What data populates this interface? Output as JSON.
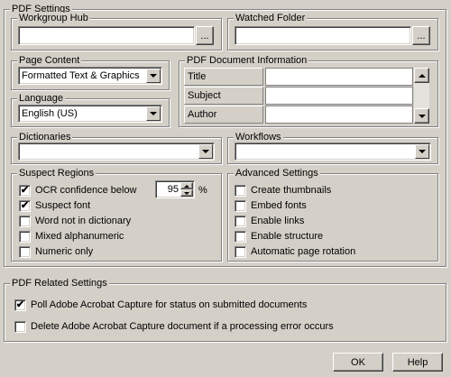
{
  "pdf_settings": {
    "title": "PDF Settings"
  },
  "workgroup_hub": {
    "label": "Workgroup Hub",
    "value": "",
    "browse": "..."
  },
  "watched_folder": {
    "label": "Watched Folder",
    "value": "",
    "browse": "..."
  },
  "page_content": {
    "label": "Page Content",
    "value": "Formatted Text & Graphics"
  },
  "language": {
    "label": "Language",
    "value": "English (US)"
  },
  "pdf_doc_info": {
    "label": "PDF Document Information",
    "rows": [
      {
        "name": "Title",
        "value": ""
      },
      {
        "name": "Subject",
        "value": ""
      },
      {
        "name": "Author",
        "value": ""
      }
    ]
  },
  "dictionaries": {
    "label": "Dictionaries",
    "value": ""
  },
  "workflows": {
    "label": "Workflows",
    "value": ""
  },
  "suspect_regions": {
    "label": "Suspect Regions",
    "items": [
      {
        "label": "OCR confidence below",
        "checked": true
      },
      {
        "label": "Suspect font",
        "checked": true
      },
      {
        "label": "Word not in dictionary",
        "checked": false
      },
      {
        "label": "Mixed alphanumeric",
        "checked": false
      },
      {
        "label": "Numeric only",
        "checked": false
      }
    ],
    "confidence_value": "95",
    "percent": "%"
  },
  "advanced_settings": {
    "label": "Advanced Settings",
    "items": [
      {
        "label": "Create thumbnails",
        "checked": false
      },
      {
        "label": "Embed fonts",
        "checked": false
      },
      {
        "label": "Enable links",
        "checked": false
      },
      {
        "label": "Enable structure",
        "checked": false
      },
      {
        "label": "Automatic page rotation",
        "checked": false
      }
    ]
  },
  "pdf_related": {
    "label": "PDF Related Settings",
    "items": [
      {
        "label": "Poll Adobe Acrobat Capture for status on submitted documents",
        "checked": true
      },
      {
        "label": "Delete Adobe Acrobat Capture document if a processing error occurs",
        "checked": false
      }
    ]
  },
  "buttons": {
    "ok": "OK",
    "help": "Help"
  },
  "glyphs": {
    "check": "✔"
  }
}
